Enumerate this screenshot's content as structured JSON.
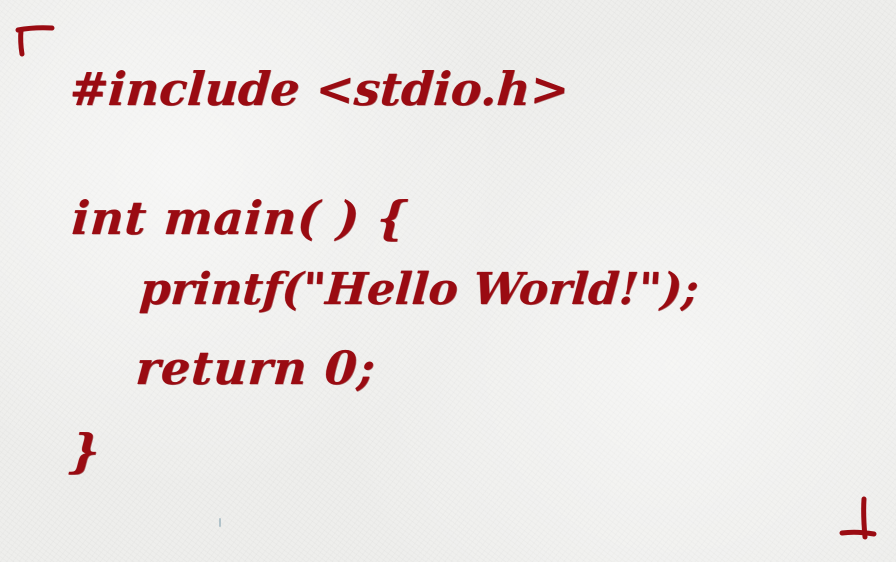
{
  "code": {
    "lines": [
      "#include <stdio.h>",
      "int main( ) {",
      "printf(\"Hello World!\");",
      "return 0;",
      "}"
    ]
  },
  "colors": {
    "ink": "#9a0b12",
    "paper": "#eeeeec"
  }
}
